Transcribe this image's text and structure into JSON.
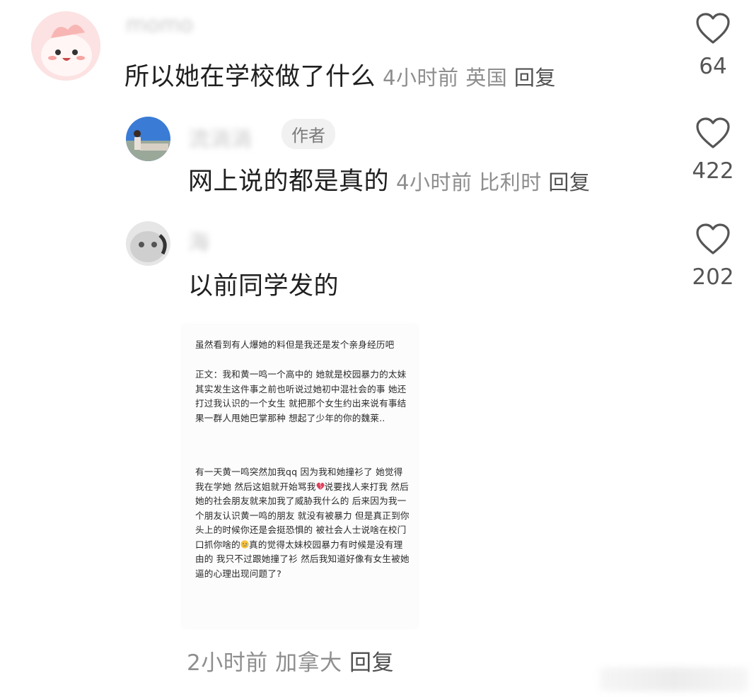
{
  "comments": [
    {
      "username": "momo",
      "text": "所以她在学校做了什么",
      "time": "4小时前",
      "location": "英国",
      "reply_label": "回复",
      "likes": "64"
    },
    {
      "username": "流淌淌",
      "author_tag": "作者",
      "text": "网上说的都是真的",
      "time": "4小时前",
      "location": "比利时",
      "reply_label": "回复",
      "likes": "422"
    },
    {
      "username": "海",
      "text": "以前同学发的",
      "likes": "202"
    }
  ],
  "post_image": {
    "heading": "虽然看到有人爆她的料但是我还是发个亲身经历吧",
    "paragraph1": "正文：我和黄一鸣一个高中的 她就是校园暴力的太妹 其实发生这件事之前也听说过她初中混社会的事 她还打过我认识的一个女生 就把那个女生约出来说有事结果一群人甩她巴掌那种 想起了少年的你的魏莱..",
    "paragraph2a": "有一天黄一鸣突然加我qq 因为我和她撞衫了 她觉得我在学她 然后这姐就开始骂我",
    "paragraph2b": "说要找人来打我 然后她的社会朋友就来加我了威胁我什么的 后来因为我一个朋友认识黄一鸣的朋友 就没有被暴力 但是真正到你头上的时候你还是会挺恐惧的 被社会人士说啥在校门口抓你啥的",
    "paragraph2c": "真的觉得太妹校园暴力有时候是没有理由的 我只不过跟她撞了衫 然后我知道好像有女生被她逼的心理出现问题了?"
  },
  "reply_meta": {
    "time": "2小时前",
    "location": "加拿大",
    "reply_label": "回复"
  },
  "colors": {
    "meta_gray": "#8e8e8e",
    "text_dark": "#1f1f1f",
    "heart_stroke": "#555555",
    "broken_heart": "#e0405a",
    "emoji_yellow": "#f5c242"
  },
  "icons": [
    "heart-outline-icon",
    "broken-heart-icon",
    "crying-face-icon"
  ]
}
